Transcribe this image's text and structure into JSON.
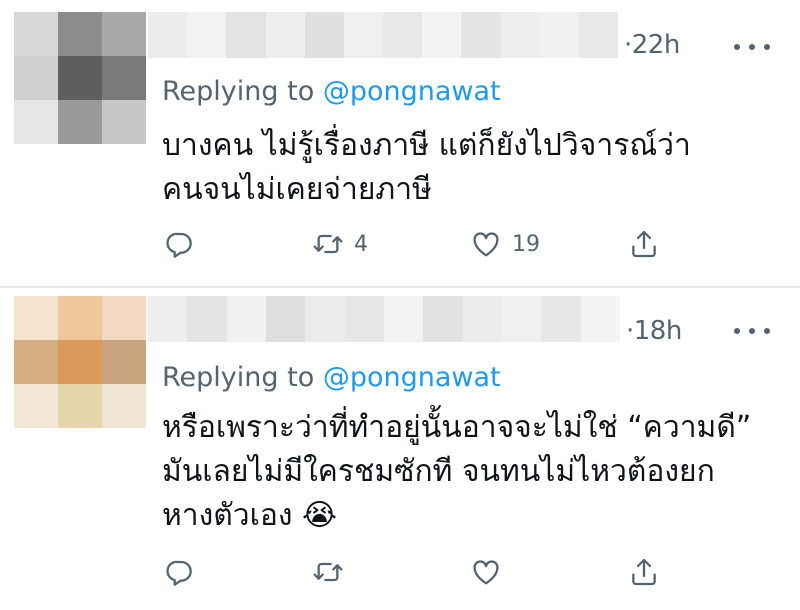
{
  "tweets": [
    {
      "time": "·22h",
      "replying_prefix": "Replying to ",
      "replying_handle": "@pongnawat",
      "lines": [
        "บางคน ไม่รู้เรื่องภาษี แต่ก็ยังไปวิจารณ์ว่า",
        "คนจนไม่เคยจ่ายภาษี"
      ],
      "retweet_count": "4",
      "like_count": "19",
      "avatar_colors": [
        "#d8d8d8",
        "#8c8c8c",
        "#a9a9a9",
        "#d0d0d0",
        "#5e5e5e",
        "#7a7a7a",
        "#e6e6e6",
        "#9a9a9a",
        "#c7c7c7"
      ],
      "name_colors": [
        "#ececec",
        "#f2f2f2",
        "#e3e3e3",
        "#eeeeee",
        "#e0e0e0",
        "#f0f0f0",
        "#e9e9e9",
        "#f3f3f3",
        "#e5e5e5",
        "#eeeeee",
        "#f1f1f1",
        "#e8e8e8"
      ]
    },
    {
      "time": "·18h",
      "replying_prefix": "Replying to ",
      "replying_handle": "@pongnawat",
      "lines": [
        "หรือเพราะว่าที่ทำอยู่นั้นอาจจะไม่ใช่ “ความดี”",
        "มันเลยไม่มีใครชมซักที จนทนไม่ไหวต้องยก",
        "หางตัวเอง 😭"
      ],
      "retweet_count": "",
      "like_count": "",
      "avatar_colors": [
        "#f6e3cf",
        "#efc79b",
        "#f3d9bf",
        "#d6ad82",
        "#d99a5a",
        "#c9a47f",
        "#f3e7d6",
        "#e5d6ad",
        "#f0e4d2"
      ],
      "name_colors": [
        "#eeeeee",
        "#e4e4e4",
        "#f1f1f1",
        "#dedede",
        "#ebebeb",
        "#e6e6e6",
        "#f2f2f2",
        "#e2e2e2",
        "#ececec",
        "#f0f0f0",
        "#e7e7e7",
        "#f4f4f4"
      ]
    }
  ],
  "icons": {
    "reply": "reply-icon",
    "retweet": "retweet-icon",
    "like": "heart-icon",
    "share": "share-icon",
    "more": "more-horizontal-icon"
  },
  "colors": {
    "link": "#1d9bf0",
    "secondary": "#536471",
    "text": "#0f1419"
  }
}
